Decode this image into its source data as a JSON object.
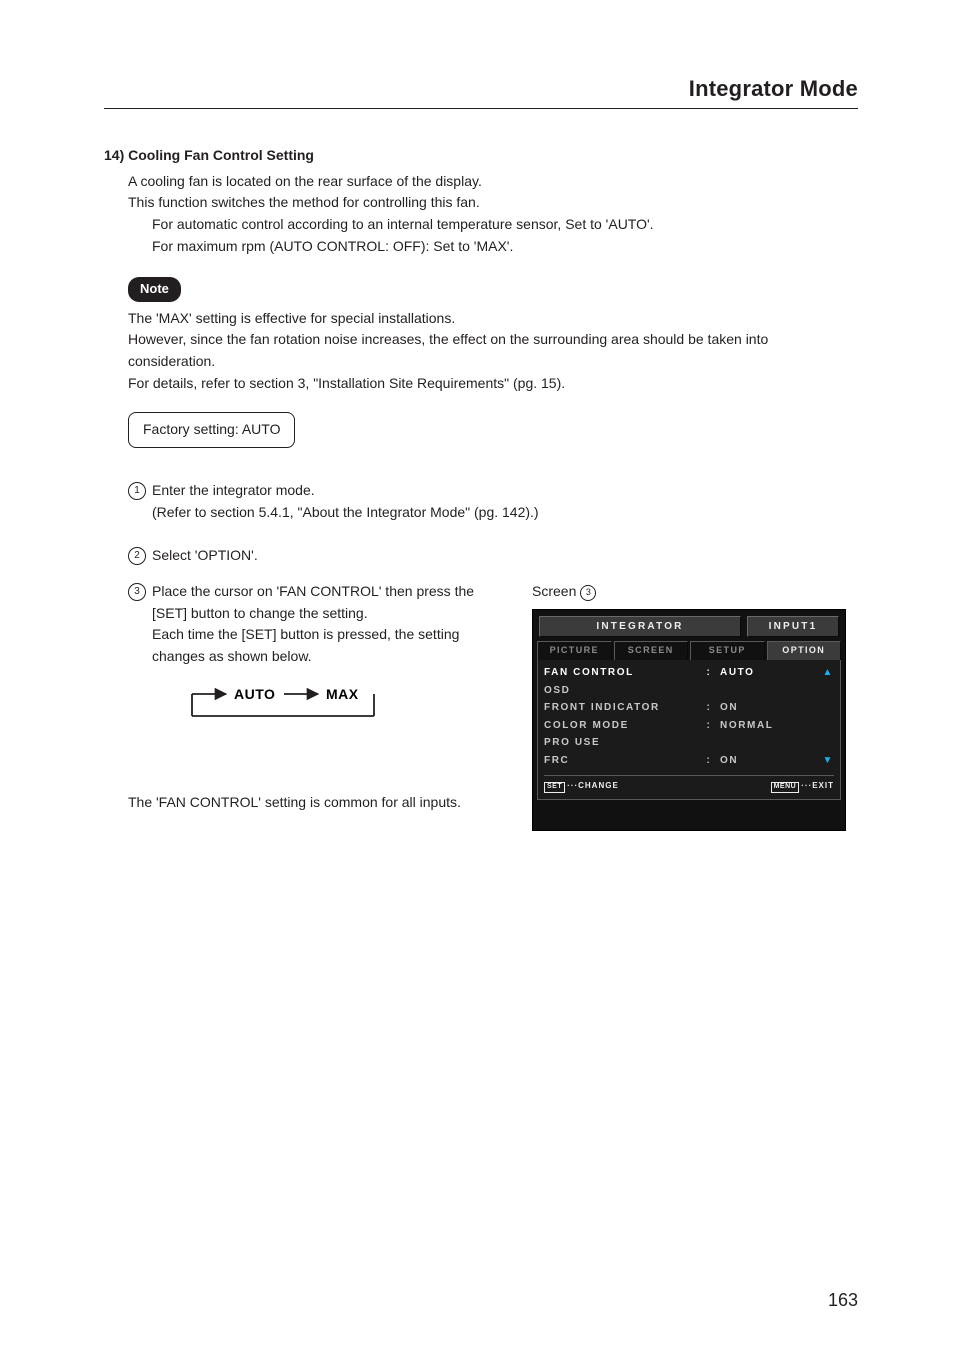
{
  "section_title": "Integrator Mode",
  "heading": "14) Cooling Fan Control Setting",
  "intro": {
    "line1": "A cooling fan is located on the rear surface of the display.",
    "line2": "This function switches the method for controlling this fan.",
    "sub1": "For automatic control according to an internal temperature sensor, Set to 'AUTO'.",
    "sub2": "For maximum rpm (AUTO CONTROL: OFF): Set to 'MAX'."
  },
  "note": {
    "label": "Note",
    "line1": "The 'MAX' setting is effective for special installations.",
    "line2": "However, since the fan rotation noise increases, the effect on the surrounding area should be taken into consideration.",
    "line3": "For details, refer to section 3, \"Installation Site Requirements\" (pg. 15)."
  },
  "factory_setting": "Factory setting:  AUTO",
  "steps": {
    "n1": "1",
    "s1": "Enter the integrator mode.",
    "s1_ref": "(Refer to section 5.4.1, \"About the Integrator Mode\" (pg. 142).)",
    "n2": "2",
    "s2": "Select 'OPTION'.",
    "n3": "3",
    "s3a": "Place the cursor on 'FAN CONTROL' then press the [SET] button to change the setting.",
    "s3b": "Each time the [SET] button is pressed, the setting changes as shown below."
  },
  "cycle": {
    "a": "AUTO",
    "b": "MAX"
  },
  "common_note": "The 'FAN CONTROL' setting is common for all inputs.",
  "screen_label": "Screen",
  "screen_num": "3",
  "osd": {
    "title_left": "INTEGRATOR",
    "title_right": "INPUT1",
    "tabs": [
      "PICTURE",
      "SCREEN",
      "SETUP",
      "OPTION"
    ],
    "active_tab_index": 3,
    "rows": [
      {
        "label": "FAN CONTROL",
        "sep": ":",
        "value": "AUTO",
        "selected": true,
        "arrow": "up"
      },
      {
        "label": "OSD",
        "sep": "",
        "value": "",
        "selected": false,
        "arrow": ""
      },
      {
        "label": "FRONT INDICATOR",
        "sep": ":",
        "value": "ON",
        "selected": false,
        "arrow": ""
      },
      {
        "label": "COLOR MODE",
        "sep": ":",
        "value": "NORMAL",
        "selected": false,
        "arrow": ""
      },
      {
        "label": "PRO USE",
        "sep": "",
        "value": "",
        "selected": false,
        "arrow": ""
      },
      {
        "label": "FRC",
        "sep": ":",
        "value": "ON",
        "selected": false,
        "arrow": "down"
      }
    ],
    "footer": {
      "set_btn": "SET",
      "set_txt": "···CHANGE",
      "menu_btn": "MENU",
      "menu_txt": "···EXIT"
    }
  },
  "page_number": "163"
}
